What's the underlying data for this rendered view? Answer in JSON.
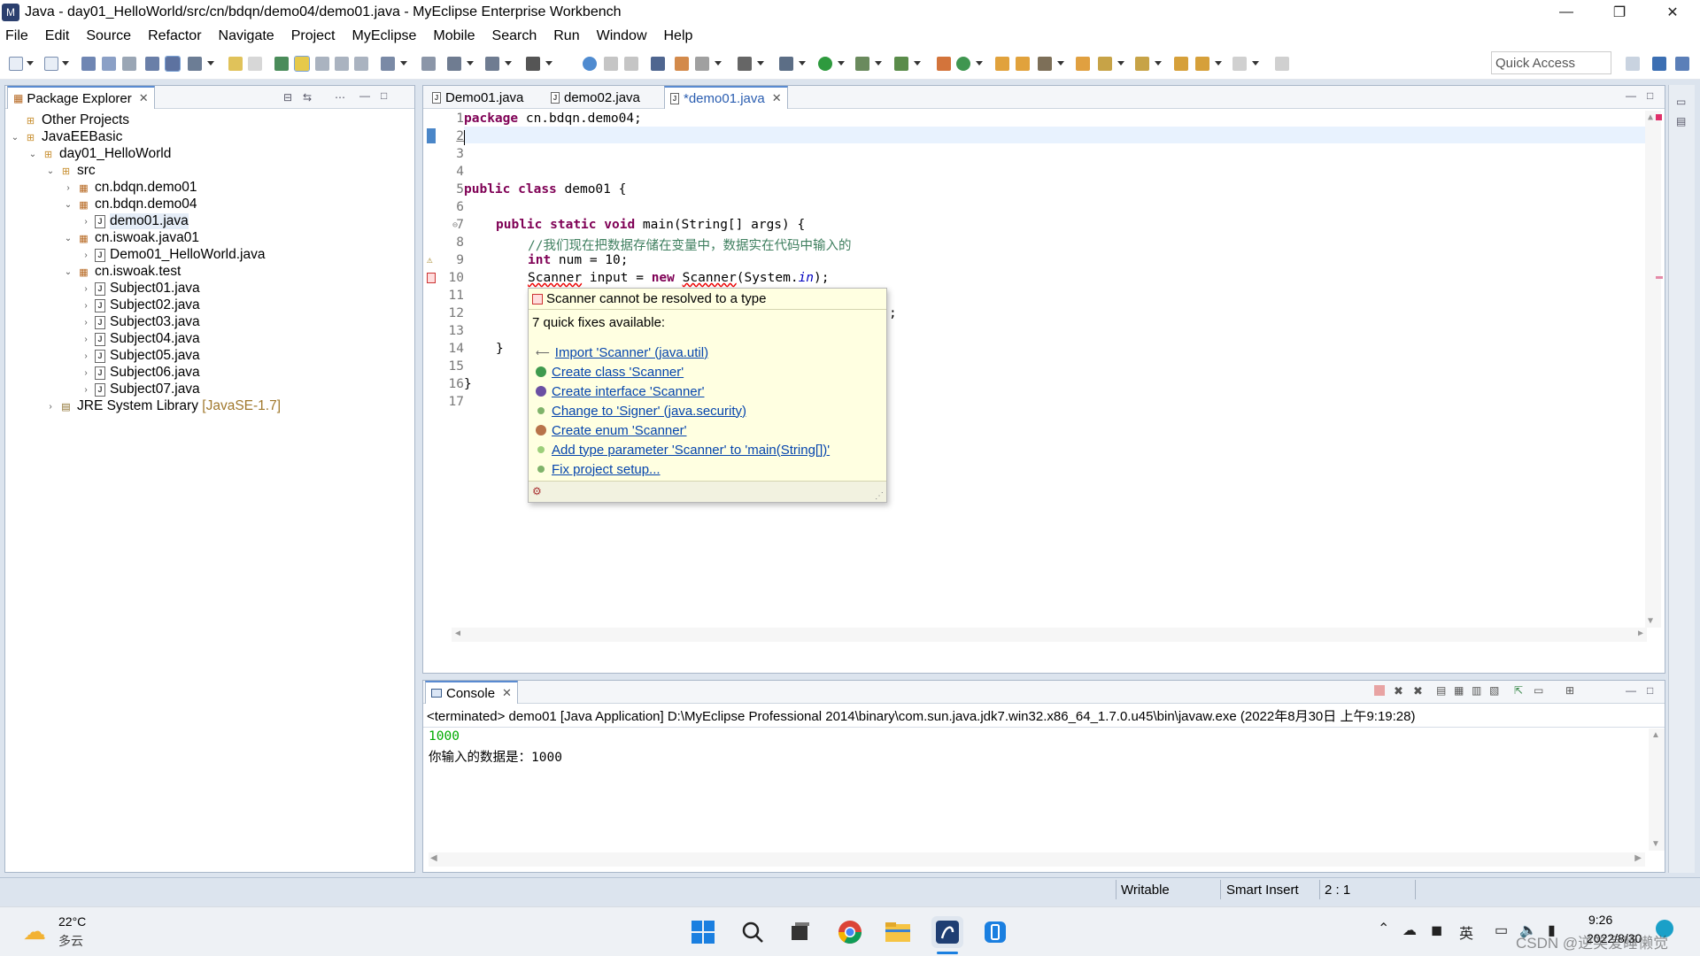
{
  "window": {
    "title": "Java - day01_HelloWorld/src/cn/bdqn/demo04/demo01.java - MyEclipse Enterprise Workbench",
    "minimize": "—",
    "maximize": "❐",
    "close": "✕"
  },
  "menu": [
    "File",
    "Edit",
    "Source",
    "Refactor",
    "Navigate",
    "Project",
    "MyEclipse",
    "Mobile",
    "Search",
    "Run",
    "Window",
    "Help"
  ],
  "toolbar": {
    "quick_access": "Quick Access"
  },
  "package_explorer": {
    "tab": "Package Explorer",
    "tree": [
      {
        "label": "Other Projects",
        "extra": ""
      },
      {
        "label": "JavaEEBasic",
        "extra": ""
      },
      {
        "label": "day01_HelloWorld",
        "extra": ""
      },
      {
        "label": "src",
        "extra": ""
      },
      {
        "label": "cn.bdqn.demo01",
        "extra": ""
      },
      {
        "label": "cn.bdqn.demo04",
        "extra": ""
      },
      {
        "label": "demo01.java",
        "extra": ""
      },
      {
        "label": "cn.iswoak.java01",
        "extra": ""
      },
      {
        "label": "Demo01_HelloWorld.java",
        "extra": ""
      },
      {
        "label": "cn.iswoak.test",
        "extra": ""
      },
      {
        "label": "Subject01.java",
        "extra": ""
      },
      {
        "label": "Subject02.java",
        "extra": ""
      },
      {
        "label": "Subject03.java",
        "extra": ""
      },
      {
        "label": "Subject04.java",
        "extra": ""
      },
      {
        "label": "Subject05.java",
        "extra": ""
      },
      {
        "label": "Subject06.java",
        "extra": ""
      },
      {
        "label": "Subject07.java",
        "extra": ""
      },
      {
        "label": "JRE System Library",
        "extra": "[JavaSE-1.7]"
      }
    ]
  },
  "editor": {
    "tabs": [
      "Demo01.java",
      "demo02.java",
      "*demo01.java"
    ],
    "line_numbers": [
      "1",
      "2",
      "3",
      "4",
      "5",
      "6",
      "7",
      "8",
      "9",
      "10",
      "11",
      "12",
      "13",
      "14",
      "15",
      "16",
      "17"
    ],
    "code": {
      "l1_kw": "package",
      "l1_rest": " cn.bdqn.demo04;",
      "l5_kw1": "public",
      "l5_kw2": "class",
      "l5_rest": " demo01 {",
      "l7_kw1": "public",
      "l7_kw2": "static",
      "l7_kw3": "void",
      "l7_rest": " main(String[] args) {",
      "l8_comment": "//我们现在把数据存储在变量中，数据实在代码中输入的",
      "l9_kw": "int",
      "l9_rest": " num = 10;",
      "l10_type": "Scanner",
      "l10_mid": " input = ",
      "l10_kw": "new",
      "l10_type2": "Scanner",
      "l10_a": "(System.",
      "l10_in": "in",
      "l10_b": ");",
      "l12_tail": ";",
      "l14": "}",
      "l16": "}"
    }
  },
  "quickfix": {
    "title": "Scanner cannot be resolved to a type",
    "subtitle": "7 quick fixes available:",
    "fixes": [
      "Import 'Scanner' (java.util)",
      "Create class 'Scanner'",
      "Create interface 'Scanner'",
      "Change to 'Signer' (java.security)",
      "Create enum 'Scanner'",
      "Add type parameter 'Scanner' to 'main(String[])'",
      "Fix project setup..."
    ]
  },
  "console": {
    "tab": "Console",
    "header": "<terminated> demo01 [Java Application] D:\\MyEclipse Professional 2014\\binary\\com.sun.java.jdk7.win32.x86_64_1.7.0.u45\\bin\\javaw.exe (2022年8月30日 上午9:19:28)",
    "lines": [
      "1000",
      "你输入的数据是：1000"
    ]
  },
  "statusbar": {
    "writable": "Writable",
    "insert_mode": "Smart Insert",
    "position": "2 : 1"
  },
  "taskbar": {
    "temp": "22°C",
    "weather": "多云",
    "ime": "英",
    "time": "9:26",
    "date": "2022/8/30",
    "watermark": "CSDN @逆笑爱睡懒觉"
  },
  "colors": {
    "keyword": "#7f0055",
    "comment": "#3f7f5f",
    "link": "#0645ad",
    "popup_bg": "#ffffe1",
    "console_input": "#00aa00"
  }
}
